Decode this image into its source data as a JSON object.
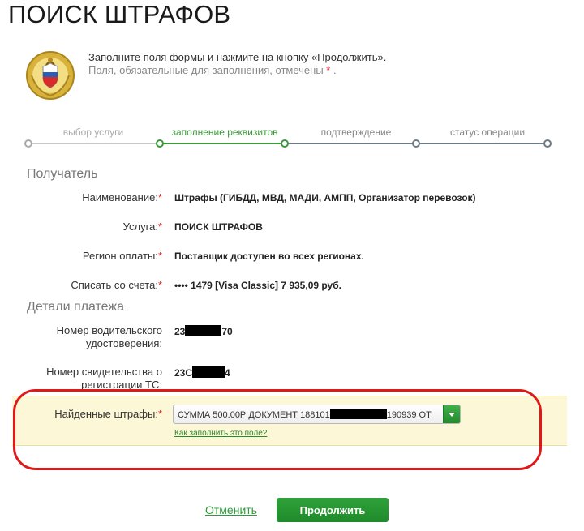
{
  "page": {
    "title": "ПОИСК ШТРАФОВ"
  },
  "intro": {
    "line1": "Заполните поля формы и нажмите на кнопку «Продолжить».",
    "line2": "Поля, обязательные для заполнения, отмечены",
    "req_mark": "*",
    "line2_end": "."
  },
  "steps": [
    {
      "label": "выбор услуги",
      "state": "done"
    },
    {
      "label": "заполнение реквизитов",
      "state": "active"
    },
    {
      "label": "подтверждение",
      "state": "pending"
    },
    {
      "label": "статус операции",
      "state": "pending"
    }
  ],
  "recipient": {
    "heading": "Получатель",
    "fields": [
      {
        "label": "Наименование:",
        "value": "Штрафы (ГИБДД, МВД, МАДИ, АМПП, Организатор перевозок)"
      },
      {
        "label": "Услуга:",
        "value": "ПОИСК ШТРАФОВ"
      },
      {
        "label": "Регион оплаты:",
        "value": "Поставщик доступен во всех регионах."
      },
      {
        "label": "Списать со счета:",
        "value": "•••• 1479  [Visa Classic] 7 935,09   руб."
      }
    ]
  },
  "details": {
    "heading": "Детали платежа",
    "license_label_1": "Номер водительского",
    "license_label_2": "удостоверения:",
    "license_prefix": "23",
    "license_suffix": "70",
    "reg_label_1": "Номер свидетельства о",
    "reg_label_2": "регистрации ТС:",
    "reg_prefix": "23С",
    "reg_suffix": "4"
  },
  "fines": {
    "label": "Найденные штрафы:",
    "select_prefix": "СУММА 500.00Р ДОКУМЕНТ 188101",
    "select_suffix": "190939 ОТ",
    "help_link": "Как заполнить это поле?"
  },
  "actions": {
    "cancel": "Отменить",
    "continue": "Продолжить"
  },
  "colors": {
    "accent": "#2fa23a",
    "required": "#e02020",
    "highlight": "#fcf7d6"
  }
}
